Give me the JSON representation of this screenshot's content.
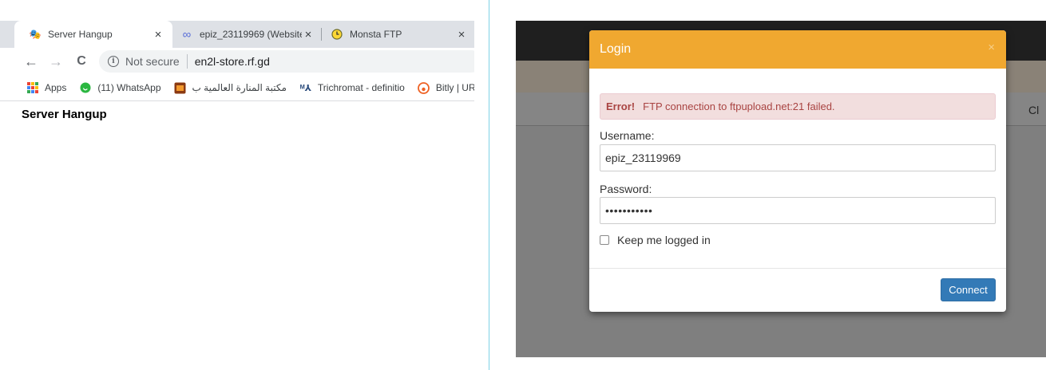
{
  "browser": {
    "tabs": [
      {
        "title": "Server Hangup",
        "icon": "person-emoji-icon",
        "close": "×"
      },
      {
        "title": "epiz_23119969 (Website",
        "icon": "infinity-icon",
        "close": "×"
      },
      {
        "title": "Monsta FTP",
        "icon": "clock-icon",
        "close": "×"
      }
    ],
    "toolbar": {
      "back": "←",
      "forward": "→",
      "reload": "C",
      "security_icon": "i",
      "security_label": "Not secure",
      "url": "en2l-store.rf.gd"
    },
    "bookmarks": [
      {
        "label": "Apps",
        "icon": "apps-grid-icon"
      },
      {
        "label": "(11) WhatsApp",
        "icon": "whatsapp-icon"
      },
      {
        "label": "مكتبة المنارة العالمية ب",
        "icon": "book-icon"
      },
      {
        "label": "Trichromat - definitio",
        "icon": "dictionary-icon"
      },
      {
        "label": "Bitly | UR",
        "icon": "bitly-icon"
      }
    ],
    "page_heading": "Server Hangup"
  },
  "ftp_app": {
    "cut_label": "Cl",
    "modal": {
      "title": "Login",
      "close": "×",
      "error_strong": "Error!",
      "error_message": "FTP connection to ftpupload.net:21 failed.",
      "username_label": "Username:",
      "username_value": "epiz_23119969",
      "password_label": "Password:",
      "password_value": "•••••••••••",
      "remember_label": "Keep me logged in",
      "connect_label": "Connect"
    }
  },
  "colors": {
    "modal_header": "#f0a830",
    "alert_bg": "#f2dede",
    "alert_text": "#a94442",
    "primary_button": "#337ab7"
  }
}
